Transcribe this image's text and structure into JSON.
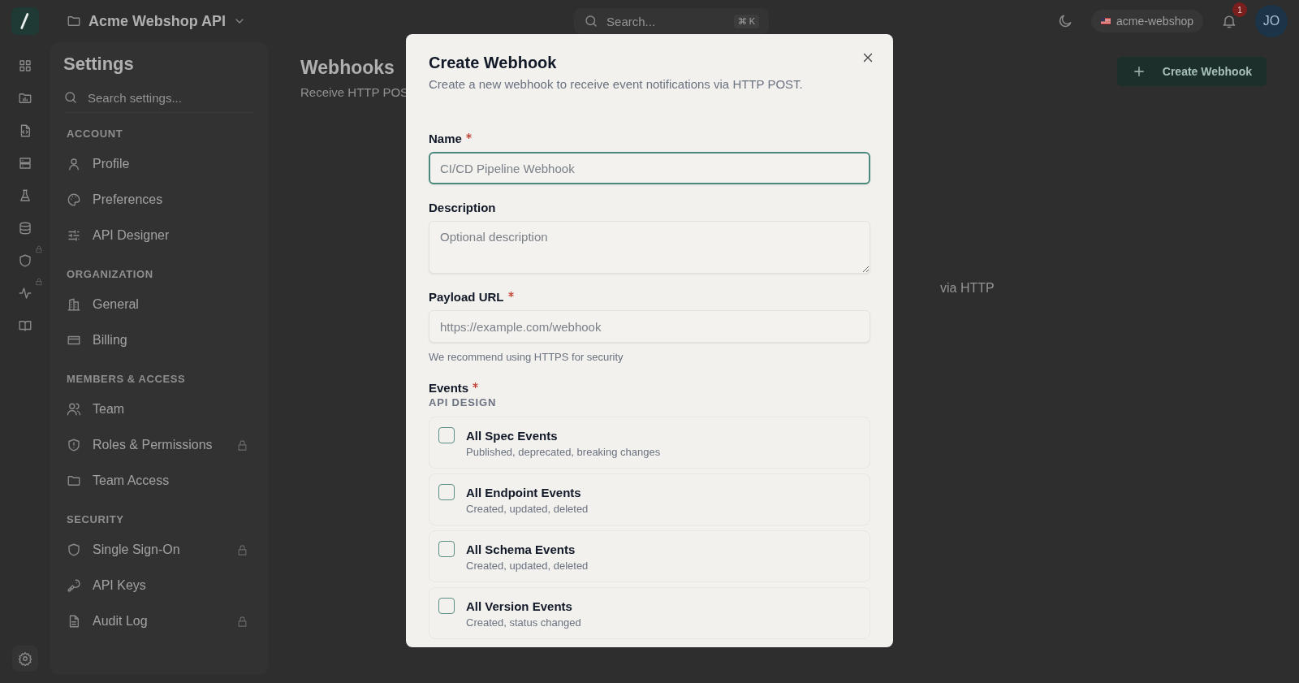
{
  "topbar": {
    "project": "Acme Webshop API",
    "search": {
      "placeholder": "Search...",
      "shortcut": "⌘ K"
    },
    "workspace": "acme-webshop",
    "notifications": "1",
    "avatar": "JO"
  },
  "rail": [
    {
      "locked": false
    },
    {
      "locked": false
    },
    {
      "locked": false
    },
    {
      "locked": false
    },
    {
      "locked": false
    },
    {
      "locked": false
    },
    {
      "locked": true
    },
    {
      "locked": true
    },
    {
      "locked": false
    }
  ],
  "settings": {
    "title": "Settings",
    "search": {
      "placeholder": "Search settings..."
    },
    "sections": [
      {
        "heading": "ACCOUNT",
        "items": [
          {
            "label": "Profile",
            "locked": false
          },
          {
            "label": "Preferences",
            "locked": false
          },
          {
            "label": "API Designer",
            "locked": false
          }
        ]
      },
      {
        "heading": "ORGANIZATION",
        "items": [
          {
            "label": "General",
            "locked": false
          },
          {
            "label": "Billing",
            "locked": false
          }
        ]
      },
      {
        "heading": "MEMBERS & ACCESS",
        "items": [
          {
            "label": "Team",
            "locked": false
          },
          {
            "label": "Roles & Permissions",
            "locked": true
          },
          {
            "label": "Team Access",
            "locked": false
          }
        ]
      },
      {
        "heading": "SECURITY",
        "items": [
          {
            "label": "Single Sign-On",
            "locked": true
          },
          {
            "label": "API Keys",
            "locked": false
          },
          {
            "label": "Audit Log",
            "locked": true
          }
        ]
      }
    ]
  },
  "page": {
    "title": "Webhooks",
    "subtitle": "Receive HTTP POS",
    "create_button": "Create Webhook",
    "empty_text": "via HTTP"
  },
  "modal": {
    "title": "Create Webhook",
    "description": "Create a new webhook to receive event notifications via HTTP POST.",
    "fields": [
      {
        "kind": "input",
        "label": "Name",
        "required": true,
        "placeholder": "CI/CD Pipeline Webhook",
        "focused": true
      },
      {
        "kind": "textarea",
        "label": "Description",
        "required": false,
        "placeholder": "Optional description",
        "focused": false
      },
      {
        "kind": "input",
        "label": "Payload URL",
        "required": true,
        "placeholder": "https://example.com/webhook",
        "focused": false,
        "hint": "We recommend using HTTPS for security"
      }
    ],
    "events": {
      "label": "Events",
      "required": true,
      "group": "API DESIGN",
      "options": [
        {
          "title": "All Spec Events",
          "description": "Published, deprecated, breaking changes",
          "checked": false
        },
        {
          "title": "All Endpoint Events",
          "description": "Created, updated, deleted",
          "checked": false
        },
        {
          "title": "All Schema Events",
          "description": "Created, updated, deleted",
          "checked": false
        },
        {
          "title": "All Version Events",
          "description": "Created, status changed",
          "checked": false
        }
      ]
    }
  }
}
